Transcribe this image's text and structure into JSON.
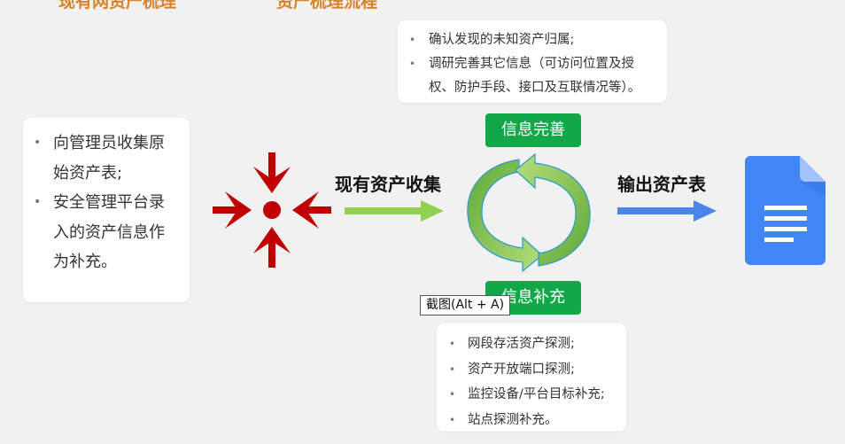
{
  "header": {
    "left_title": "现有网资产梳理",
    "right_title": "资产梳理流程"
  },
  "left_card": {
    "items": [
      "向管理员收集原始资产表;",
      "安全管理平台录入的资产信息作为补充。"
    ],
    "lines": [
      "向管理员收集原",
      "始资产表;",
      "安全管理平台录",
      "入的资产信息作",
      "为补充。"
    ]
  },
  "top_card": {
    "items": [
      "确认发现的未知资产归属;",
      "调研完善其它信息（可访问位置及授权、防护手段、接口及互联情况等）。"
    ],
    "lines": [
      "确认发现的未知资产归属;",
      "调研完善其它信息（可访问位置及授",
      "权、防护手段、接口及互联情况等）。"
    ]
  },
  "bottom_card": {
    "items": [
      "网段存活资产探测;",
      "资产开放端口探测;",
      "监控设备/平台目标补充;",
      "站点探测补充。"
    ]
  },
  "flow": {
    "collect_label": "现有资产收集",
    "output_label": "输出资产表",
    "cycle_top_label": "信息完善",
    "cycle_bottom_label": "信息补充"
  },
  "tooltip": {
    "text": "截图(Alt + A)"
  },
  "icons": {
    "converge": "converge-arrows-icon",
    "cycle": "cycle-arrows-icon",
    "document": "document-icon"
  },
  "colors": {
    "accent_red": "#c00000",
    "green_arrow": "#92d050",
    "pill_green": "#12a84a",
    "blue_arrow": "#4a86e8",
    "doc_blue": "#4285f4"
  }
}
